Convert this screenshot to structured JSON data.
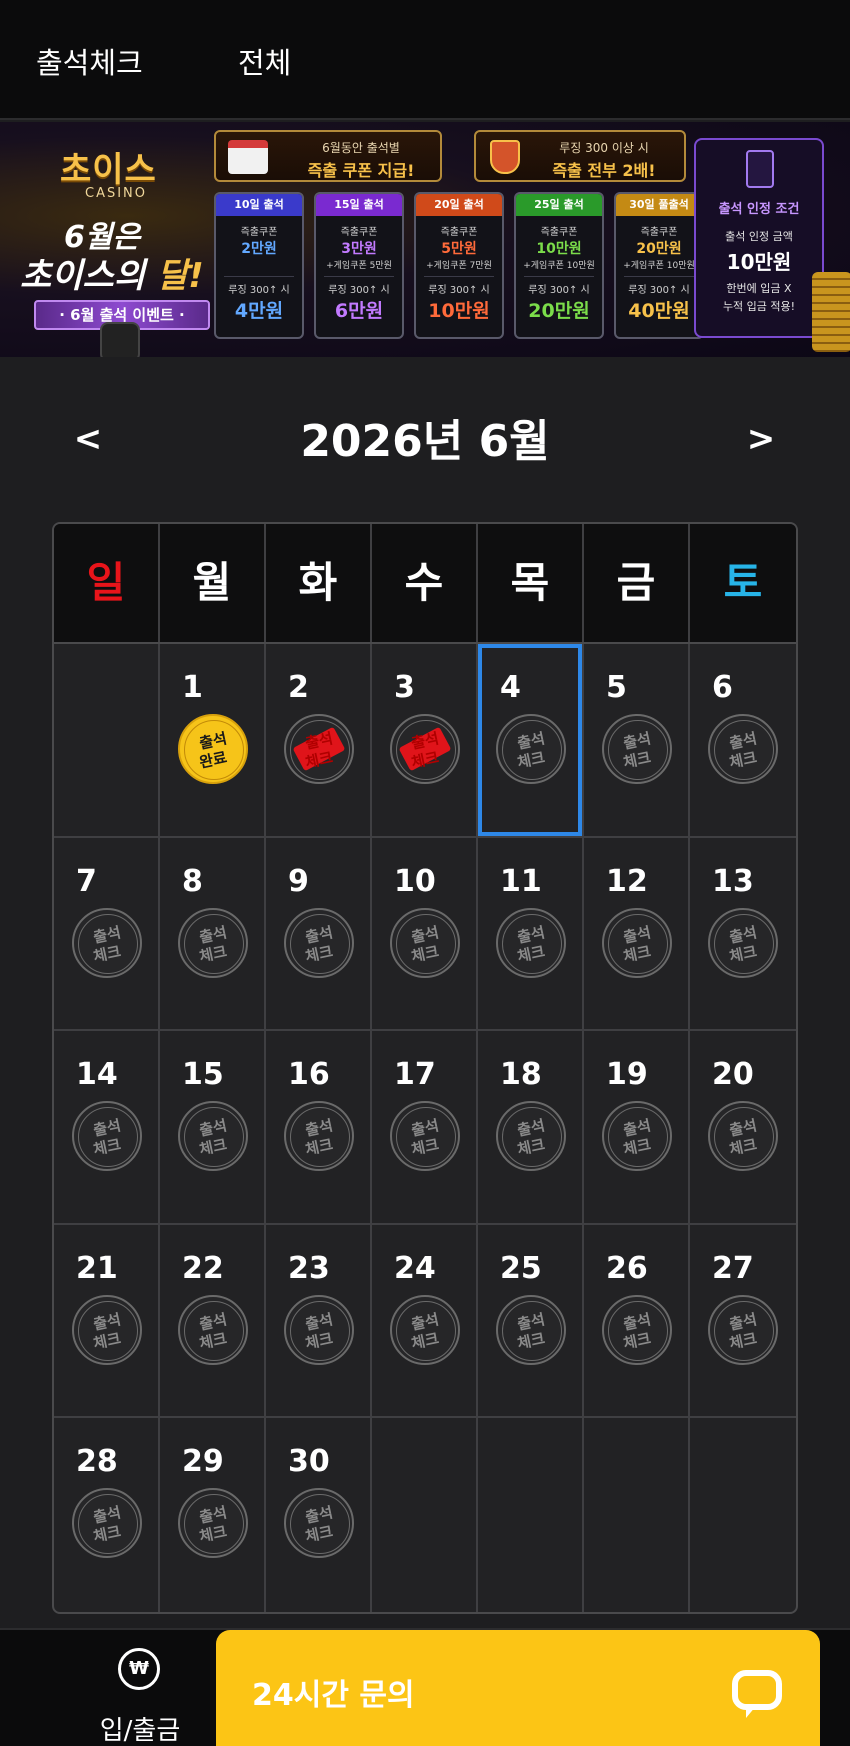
{
  "header": {
    "tab_attendance": "출석체크",
    "tab_all": "전체"
  },
  "banner": {
    "logo_main": "초이스",
    "logo_sub": "CASINO",
    "title_line1": "6월은",
    "title_line2_a": "초이스의 ",
    "title_line2_b": "달!",
    "ribbon": "· 6월 출석 이벤트 ·",
    "promo1_line1": "6월동안 출석별",
    "promo1_line2": "즉출 쿠폰 지급!",
    "promo2_line1": "루징 300 이상 시",
    "promo2_line2": "즉출 전부 2배!",
    "rewards": [
      {
        "head": "10일 출석",
        "coupon": "즉출쿠폰",
        "amount": "2만원",
        "bonus": "",
        "cond": "루징 300↑ 시",
        "big": "4만원"
      },
      {
        "head": "15일 출석",
        "coupon": "즉출쿠폰",
        "amount": "3만원",
        "bonus": "+게임쿠폰 5만원",
        "cond": "루징 300↑ 시",
        "big": "6만원"
      },
      {
        "head": "20일 출석",
        "coupon": "즉출쿠폰",
        "amount": "5만원",
        "bonus": "+게임쿠폰 7만원",
        "cond": "루징 300↑ 시",
        "big": "10만원"
      },
      {
        "head": "25일 출석",
        "coupon": "즉출쿠폰",
        "amount": "10만원",
        "bonus": "+게임쿠폰 10만원",
        "cond": "루징 300↑ 시",
        "big": "20만원"
      },
      {
        "head": "30일 풀출석",
        "coupon": "즉출쿠폰",
        "amount": "20만원",
        "bonus": "+게임쿠폰 10만원",
        "cond": "루징 300↑ 시",
        "big": "40만원"
      }
    ],
    "cond_title": "출석 인정 조건",
    "cond_line1": "출석 인정 금액",
    "cond_amount": "10만원",
    "cond_line2": "한번에 입금 X",
    "cond_line3": "누적 입금 적용!"
  },
  "calendar_nav": {
    "prev": "<",
    "next": ">",
    "title": "2026년 6월"
  },
  "calendar": {
    "weekdays": [
      "일",
      "월",
      "화",
      "수",
      "목",
      "금",
      "토"
    ],
    "weekday_colors": [
      "#e8141a",
      "#ffffff",
      "#ffffff",
      "#ffffff",
      "#ffffff",
      "#ffffff",
      "#27b4e8"
    ],
    "first_weekday": 1,
    "days": [
      "1",
      "2",
      "3",
      "4",
      "5",
      "6",
      "7",
      "8",
      "9",
      "10",
      "11",
      "12",
      "13",
      "14",
      "15",
      "16",
      "17",
      "18",
      "19",
      "20",
      "21",
      "22",
      "23",
      "24",
      "25",
      "26",
      "27",
      "28",
      "29",
      "30"
    ],
    "status": {
      "1": "done",
      "2": "missed",
      "3": "missed"
    },
    "today": "4",
    "stamp_default": [
      "출석",
      "체크"
    ],
    "stamp_done": [
      "출석",
      "완료"
    ]
  },
  "bottom": {
    "wallet_icon": "₩",
    "wallet_label": "입/출금",
    "support_label": "24시간 문의"
  },
  "colors": {
    "accent": "#fcc515",
    "today_border": "#2e88e8",
    "sunday": "#e8141a",
    "saturday": "#27b4e8"
  }
}
